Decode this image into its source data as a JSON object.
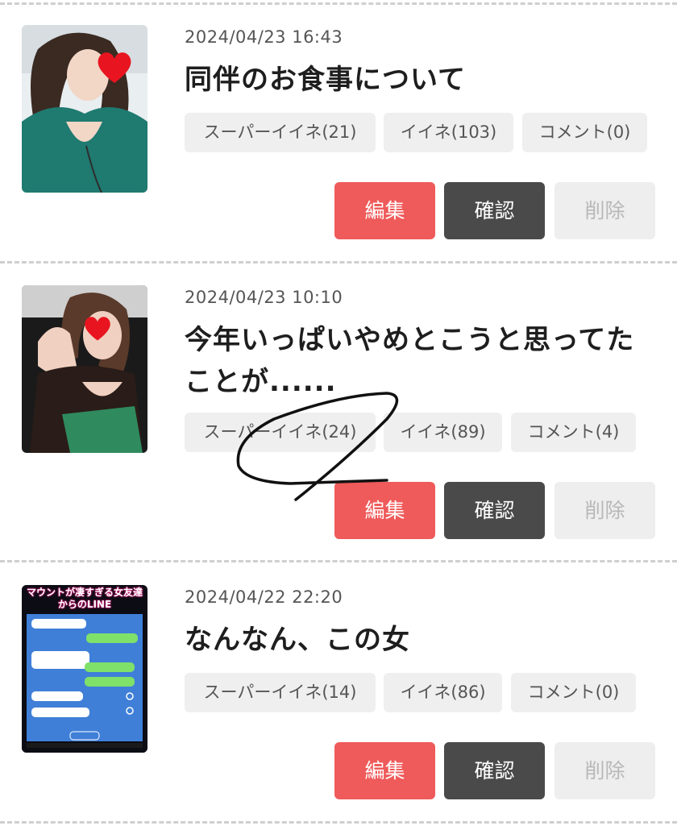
{
  "posts": [
    {
      "date": "2024/04/23 16:43",
      "title": "同伴のお食事について",
      "tags": {
        "super_like": "スーパーイイネ(21)",
        "like": "イイネ(103)",
        "comment": "コメント(0)"
      },
      "buttons": {
        "edit": "編集",
        "check": "確認",
        "delete": "削除"
      }
    },
    {
      "date": "2024/04/23 10:10",
      "title": "今年いっぱいやめとこうと思ってたことが......",
      "tags": {
        "super_like": "スーパーイイネ(24)",
        "like": "イイネ(89)",
        "comment": "コメント(4)"
      },
      "buttons": {
        "edit": "編集",
        "check": "確認",
        "delete": "削除"
      }
    },
    {
      "date": "2024/04/22 22:20",
      "title": "なんなん、この女",
      "tags": {
        "super_like": "スーパーイイネ(14)",
        "like": "イイネ(86)",
        "comment": "コメント(0)"
      },
      "buttons": {
        "edit": "編集",
        "check": "確認",
        "delete": "削除"
      },
      "thumb_text": "マウントが凄すぎる女友達からのLINE"
    }
  ],
  "colors": {
    "edit": "#ef5a5a",
    "check": "#4a4a4a",
    "delete_bg": "#eeeeee",
    "tag_bg": "#efefef"
  }
}
